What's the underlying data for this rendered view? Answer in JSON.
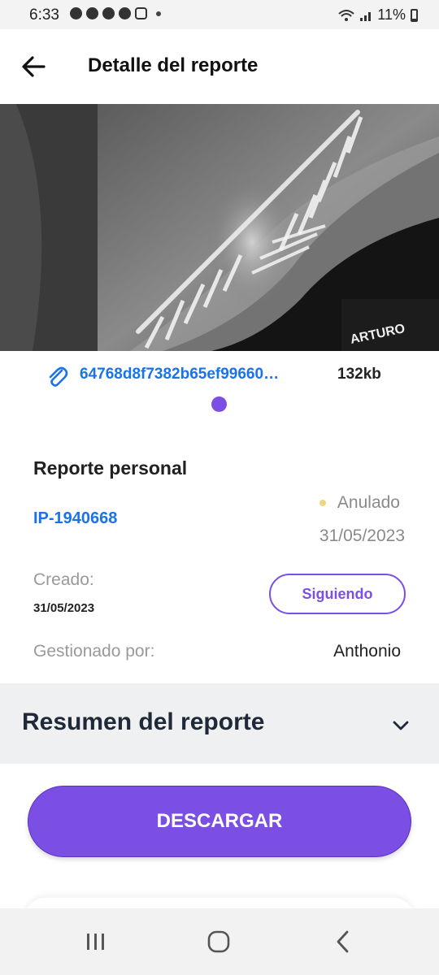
{
  "status_bar": {
    "time": "6:33",
    "battery": "11%",
    "icons": [
      "messenger-icon",
      "snapchat-icon",
      "snapchat-icon",
      "whatsapp-icon",
      "instagram-icon",
      "dot-icon",
      "wifi-icon",
      "signal-icon",
      "battery-icon"
    ]
  },
  "app_bar": {
    "title": "Detalle del reporte",
    "back_icon": "arrow-left-icon"
  },
  "image": {
    "watermark": "ARTURO"
  },
  "attachment": {
    "icon": "paperclip-icon",
    "file_name": "64768d8f7382b65ef99660…",
    "file_size": "132kb"
  },
  "report": {
    "type": "Reporte personal",
    "id": "IP-1940668",
    "status": "Anulado",
    "date": "31/05/2023",
    "created_label": "Creado:",
    "created_date": "31/05/2023",
    "follow_label": "Siguiendo",
    "managed_label": "Gestionado por:",
    "managed_by": "Anthonio"
  },
  "summary": {
    "title": "Resumen del reporte",
    "icon": "chevron-down-icon"
  },
  "download": {
    "label": "DESCARGAR"
  },
  "colors": {
    "accent": "#7b4fe3",
    "link": "#1a73e8",
    "status_dot": "#f0d680",
    "muted_text": "#8a8a8a",
    "summary_bg": "#eff0f2"
  }
}
